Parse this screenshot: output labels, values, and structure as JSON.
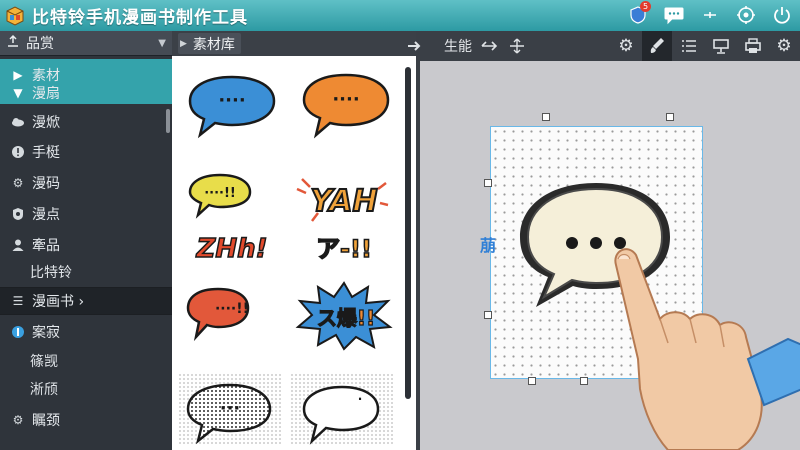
{
  "window": {
    "title": "比特铃手机漫画书制作工具",
    "notification_count": "5"
  },
  "sidebar": {
    "header": "品赏",
    "items": [
      {
        "label": "素材"
      },
      {
        "label": "漫扇"
      },
      {
        "label": "漫焮"
      },
      {
        "label": "手梃"
      },
      {
        "label": "漫码"
      },
      {
        "label": "漫点"
      },
      {
        "label": "牽品"
      },
      {
        "label": "比特铃"
      },
      {
        "label": "漫画书 ›"
      },
      {
        "label": "案寂"
      },
      {
        "label": "篠觊"
      },
      {
        "label": "淅颀"
      },
      {
        "label": "瞩颈"
      }
    ]
  },
  "material_panel": {
    "tab_label": "素材库",
    "stickers": [
      {
        "text": "····",
        "color": "#3b8fd6"
      },
      {
        "text": "····",
        "color": "#ee8a33"
      },
      {
        "text": "····!!",
        "color": "#e8dd4a"
      },
      {
        "text": "YAH",
        "color": "#f0a23a"
      },
      {
        "text": "ZHh!",
        "color": "#e24a2c"
      },
      {
        "text": "ア-!!",
        "color": "#f0a23a"
      },
      {
        "text": "····!!",
        "color": "#e2583a"
      },
      {
        "text": "ス爆!!",
        "color": "#3b8fd6"
      },
      {
        "text": "···",
        "color": "#dddddd"
      },
      {
        "text": "·",
        "color": "#ffffff"
      }
    ]
  },
  "toolbar": {
    "label": "生能"
  },
  "canvas": {
    "side_label": "萠",
    "bubble_color": "#f5efd9"
  },
  "colors": {
    "accent": "#34a3ab",
    "title_bar": "#2d9aa3"
  }
}
